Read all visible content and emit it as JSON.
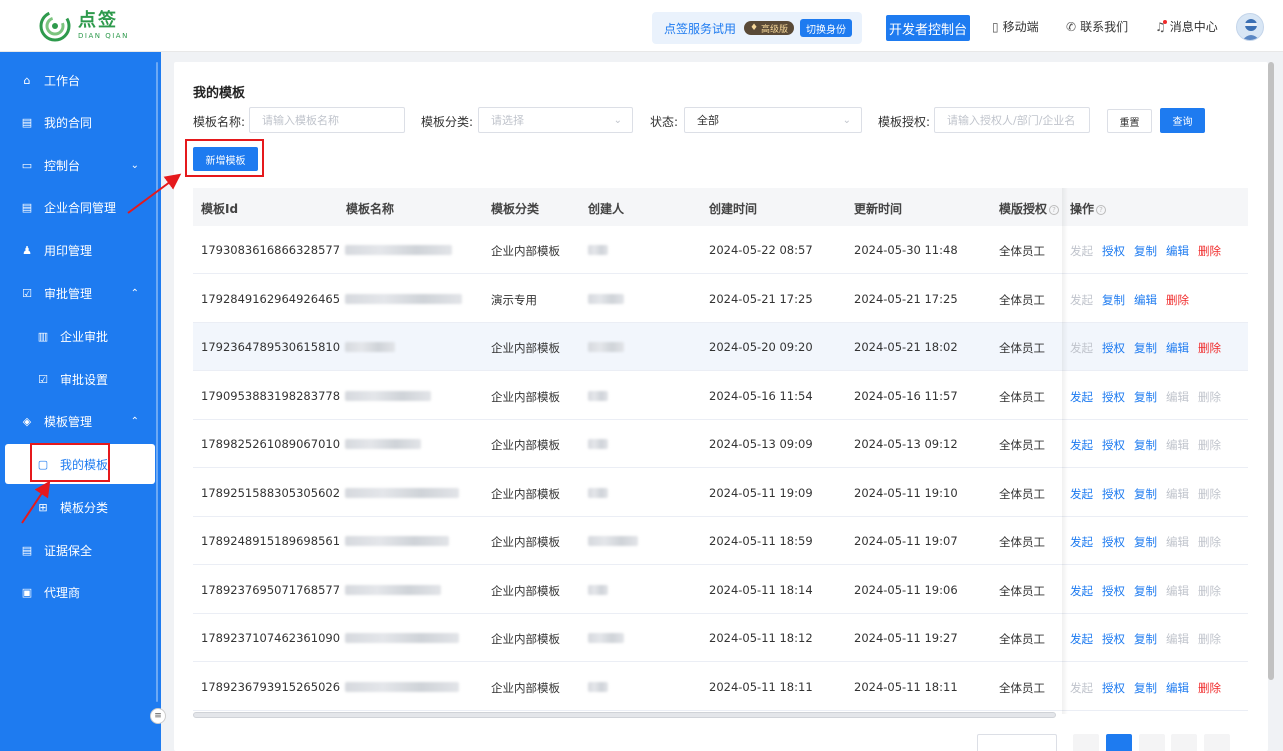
{
  "header": {
    "logo_cn": "点签",
    "logo_en": "DIAN QIAN",
    "trial_text": "点签服务试用",
    "vip_badge": "高级版",
    "switch_identity": "切换身份",
    "dev_console": "开发者控制台",
    "mobile": "移动端",
    "contact": "联系我们",
    "messages": "消息中心"
  },
  "sidebar": {
    "items": [
      {
        "label": "工作台",
        "icon": "home-icon"
      },
      {
        "label": "我的合同",
        "icon": "document-icon"
      },
      {
        "label": "控制台",
        "icon": "console-icon"
      },
      {
        "label": "企业合同管理",
        "icon": "document-icon"
      },
      {
        "label": "用印管理",
        "icon": "user-icon"
      },
      {
        "label": "审批管理",
        "icon": "check-icon"
      },
      {
        "label": "企业审批",
        "icon": "building-icon"
      },
      {
        "label": "审批设置",
        "icon": "check-square-icon"
      },
      {
        "label": "模板管理",
        "icon": "layers-icon"
      },
      {
        "label": "我的模板",
        "icon": "file-icon"
      },
      {
        "label": "模板分类",
        "icon": "grid-icon"
      },
      {
        "label": "证据保全",
        "icon": "document-icon"
      },
      {
        "label": "代理商",
        "icon": "briefcase-icon"
      }
    ]
  },
  "main": {
    "title": "我的模板",
    "filters": {
      "name_label": "模板名称:",
      "name_placeholder": "请输入模板名称",
      "category_label": "模板分类:",
      "category_placeholder": "请选择",
      "status_label": "状态:",
      "status_value": "全部",
      "auth_label": "模板授权:",
      "auth_placeholder": "请输入授权人/部门/企业名"
    },
    "reset_label": "重置",
    "query_label": "查询",
    "new_label": "新增模板"
  },
  "table": {
    "columns": [
      "模板Id",
      "模板名称",
      "模板分类",
      "创建人",
      "创建时间",
      "更新时间",
      "模版授权",
      "操作"
    ],
    "actions": [
      "发起",
      "授权",
      "复制",
      "编辑",
      "删除"
    ],
    "rows": [
      {
        "id": "1793083616866328577",
        "category": "企业内部模板",
        "created": "2024-05-22 08:57",
        "updated": "2024-05-30 11:48",
        "auth": "全体员工"
      },
      {
        "id": "1792849162964926465",
        "category": "演示专用",
        "created": "2024-05-21 17:25",
        "updated": "2024-05-21 17:25",
        "auth": "全体员工"
      },
      {
        "id": "1792364789530615810",
        "category": "企业内部模板",
        "created": "2024-05-20 09:20",
        "updated": "2024-05-21 18:02",
        "auth": "全体员工"
      },
      {
        "id": "1790953883198283778",
        "category": "企业内部模板",
        "created": "2024-05-16 11:54",
        "updated": "2024-05-16 11:57",
        "auth": "全体员工"
      },
      {
        "id": "1789825261089067010",
        "category": "企业内部模板",
        "created": "2024-05-13 09:09",
        "updated": "2024-05-13 09:12",
        "auth": "全体员工"
      },
      {
        "id": "1789251588305305602",
        "category": "企业内部模板",
        "created": "2024-05-11 19:09",
        "updated": "2024-05-11 19:10",
        "auth": "全体员工"
      },
      {
        "id": "1789248915189698561",
        "category": "企业内部模板",
        "created": "2024-05-11 18:59",
        "updated": "2024-05-11 19:07",
        "auth": "全体员工"
      },
      {
        "id": "1789237695071768577",
        "category": "企业内部模板",
        "created": "2024-05-11 18:14",
        "updated": "2024-05-11 19:06",
        "auth": "全体员工"
      },
      {
        "id": "1789237107462361090",
        "category": "企业内部模板",
        "created": "2024-05-11 18:12",
        "updated": "2024-05-11 19:27",
        "auth": "全体员工"
      },
      {
        "id": "1789236793915265026",
        "category": "企业内部模板",
        "created": "2024-05-11 18:11",
        "updated": "2024-05-11 18:11",
        "auth": "全体员工"
      }
    ]
  },
  "colors": {
    "primary": "#1e7bf0",
    "danger": "#f02a2a",
    "disabled": "#c0c4cc",
    "annotation_red": "#e5191c"
  }
}
